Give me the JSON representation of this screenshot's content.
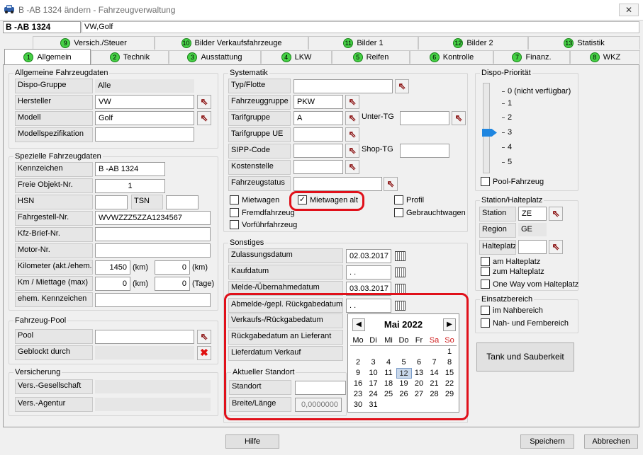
{
  "window": {
    "title": "B  -AB 1324 ändern - Fahrzeugverwaltung",
    "close": "✕"
  },
  "header": {
    "plate": "B  -AB 1324",
    "model": "VW,Golf"
  },
  "tabs_row1": [
    {
      "num": "9",
      "label": "Versich./Steuer"
    },
    {
      "num": "10",
      "label": "Bilder Verkaufsfahrzeuge"
    },
    {
      "num": "11",
      "label": "Bilder 1"
    },
    {
      "num": "12",
      "label": "Bilder 2"
    },
    {
      "num": "13",
      "label": "Statistik"
    }
  ],
  "tabs_row2": [
    {
      "num": "1",
      "label": "Allgemein"
    },
    {
      "num": "2",
      "label": "Technik"
    },
    {
      "num": "3",
      "label": "Ausstattung"
    },
    {
      "num": "4",
      "label": "LKW"
    },
    {
      "num": "5",
      "label": "Reifen"
    },
    {
      "num": "6",
      "label": "Kontrolle"
    },
    {
      "num": "7",
      "label": "Finanz."
    },
    {
      "num": "8",
      "label": "WKZ"
    }
  ],
  "allg": {
    "title": "Allgemeine Fahrzeugdaten",
    "dispo_label": "Dispo-Gruppe",
    "dispo_value": "Alle",
    "hersteller_label": "Hersteller",
    "hersteller_value": "VW",
    "modell_label": "Modell",
    "modell_value": "Golf",
    "spez_label": "Modellspezifikation",
    "spez_value": ""
  },
  "spez": {
    "title": "Spezielle Fahrzeugdaten",
    "kenn_label": "Kennzeichen",
    "kenn_value": "B  -AB 1324",
    "freie_label": "Freie Objekt-Nr.",
    "freie_value": "1",
    "hsn_label": "HSN",
    "tsn_label": "TSN",
    "fgst_label": "Fahrgestell-Nr.",
    "fgst_value": "WVWZZZ5ZZA1234567",
    "kfzbrief_label": "Kfz-Brief-Nr.",
    "motor_label": "Motor-Nr.",
    "km_label": "Kilometer (akt./ehem.)",
    "km_akt": "1450",
    "km_unit1": "(km)",
    "km_ehem": "0",
    "km_unit2": "(km)",
    "miet_label": "Km / Miettage (max)",
    "miet_km": "0",
    "miet_unit1": "(km)",
    "miet_tage": "0",
    "miet_unit2": "(Tage)",
    "ehem_label": "ehem. Kennzeichen"
  },
  "pool": {
    "title": "Fahrzeug-Pool",
    "pool_label": "Pool",
    "geblockt_label": "Geblockt durch"
  },
  "vers": {
    "title": "Versicherung",
    "ges_label": "Vers.-Gesellschaft",
    "agentur_label": "Vers.-Agentur"
  },
  "syst": {
    "title": "Systematik",
    "typ_label": "Typ/Flotte",
    "fzgruppe_label": "Fahrzeuggruppe",
    "fzgruppe_value": "PKW",
    "tarif_label": "Tarifgruppe",
    "tarif_value": "A",
    "untertg_label": "Unter-TG",
    "tarifue_label": "Tarifgruppe UE",
    "sipp_label": "SIPP-Code",
    "shoptg_label": "Shop-TG",
    "kosten_label": "Kostenstelle",
    "status_label": "Fahrzeugstatus",
    "mietwagen": "Mietwagen",
    "mietwagen_alt": "Mietwagen alt",
    "profil": "Profil",
    "fremd": "Fremdfahrzeug",
    "gebraucht": "Gebrauchtwagen",
    "vorfuehr": "Vorführfahrzeug"
  },
  "sonst": {
    "title": "Sonstiges",
    "zul_label": "Zulassungsdatum",
    "zul_value": "02.03.2017",
    "kauf_label": "Kaufdatum",
    "kauf_value": " .  .",
    "melde_label": "Melde-/Übernahmedatum",
    "melde_value": "03.03.2017",
    "abmelde_label": "Abmelde-/gepl. Rückgabedatum",
    "abmelde_value": " .  .",
    "verkauf_label": "Verkaufs-/Rückgabedatum",
    "rueckgabe_label": "Rückgabedatum an Lieferant",
    "liefer_label": "Lieferdatum Verkauf"
  },
  "standort": {
    "title": "Aktueller Standort",
    "standort_label": "Standort",
    "breite_label": "Breite/Länge",
    "breite_value": "0,0000000"
  },
  "calendar": {
    "month": "Mai 2022",
    "prev": "◀",
    "next": "▶",
    "weekdays": [
      "Mo",
      "Di",
      "Mi",
      "Do",
      "Fr",
      "Sa",
      "So"
    ],
    "days": [
      "",
      "",
      "",
      "",
      "",
      "",
      "1",
      "2",
      "3",
      "4",
      "5",
      "6",
      "7",
      "8",
      "9",
      "10",
      "11",
      "12",
      "13",
      "14",
      "15",
      "16",
      "17",
      "18",
      "19",
      "20",
      "21",
      "22",
      "23",
      "24",
      "25",
      "26",
      "27",
      "28",
      "29",
      "30",
      "31"
    ],
    "selected": "12",
    "weekend_color": "#d02020"
  },
  "dispo": {
    "title": "Dispo-Priorität",
    "levels": [
      "0 (nicht verfügbar)",
      "1",
      "2",
      "3",
      "4",
      "5"
    ],
    "current_level": 3,
    "pool_fahrzeug": "Pool-Fahrzeug"
  },
  "station": {
    "title": "Station/Halteplatz",
    "station_label": "Station",
    "station_value": "ZE",
    "region_label": "Region",
    "region_value": "GE",
    "halteplatz_label": "Halteplatz",
    "am_halteplatz": "am Halteplatz",
    "zum_halteplatz": "zum Halteplatz",
    "oneway": "One Way vom Halteplatz"
  },
  "einsatz": {
    "title": "Einsatzbereich",
    "nah": "im Nahbereich",
    "fern": "Nah- und Fernbereich"
  },
  "tank_button": "Tank und Sauberkeit",
  "footer": {
    "hilfe": "Hilfe",
    "speichern": "Speichern",
    "abbrechen": "Abbrechen"
  },
  "colors": {
    "highlight": "#e0101a",
    "tab_number": "#46d046",
    "lookup_arrow": "#8a1010"
  }
}
